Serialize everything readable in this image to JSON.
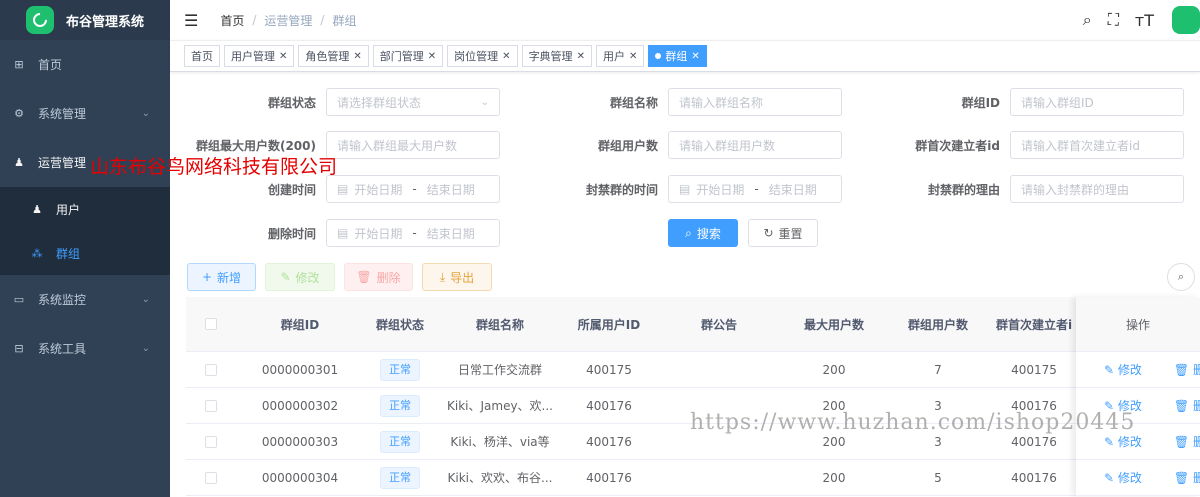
{
  "app": {
    "title": "布谷管理系统"
  },
  "sidebar": {
    "items": [
      {
        "label": "首页",
        "icon": "dashboard-icon"
      },
      {
        "label": "系统管理",
        "icon": "gear-icon"
      },
      {
        "label": "运营管理",
        "icon": "users-icon"
      },
      {
        "label": "系统监控",
        "icon": "monitor-icon"
      },
      {
        "label": "系统工具",
        "icon": "toolbox-icon"
      }
    ],
    "sub": [
      {
        "label": "用户"
      },
      {
        "label": "群组"
      }
    ]
  },
  "breadcrumb": {
    "home": "首页",
    "section": "运营管理",
    "current": "群组"
  },
  "tabs": [
    {
      "label": "首页"
    },
    {
      "label": "用户管理"
    },
    {
      "label": "角色管理"
    },
    {
      "label": "部门管理"
    },
    {
      "label": "岗位管理"
    },
    {
      "label": "字典管理"
    },
    {
      "label": "用户"
    },
    {
      "label": "群组"
    }
  ],
  "form": {
    "status_label": "群组状态",
    "status_placeholder": "请选择群组状态",
    "name_label": "群组名称",
    "name_placeholder": "请输入群组名称",
    "id_label": "群组ID",
    "id_placeholder": "请输入群组ID",
    "max_label": "群组最大用户数(200)",
    "max_placeholder": "请输入群组最大用户数",
    "users_label": "群组用户数",
    "users_placeholder": "请输入群组用户数",
    "creator_label": "群首次建立者id",
    "creator_placeholder": "请输入群首次建立者id",
    "created_label": "创建时间",
    "banned_label": "封禁群的时间",
    "reason_label": "封禁群的理由",
    "reason_placeholder": "请输入封禁群的理由",
    "deleted_label": "删除时间",
    "start_placeholder": "开始日期",
    "date_sep": "-",
    "end_placeholder": "结束日期",
    "search_label": "搜索",
    "reset_label": "重置"
  },
  "toolbar": {
    "add": "新增",
    "edit": "修改",
    "delete": "删除",
    "export": "导出"
  },
  "table": {
    "headers": [
      "群组ID",
      "群组状态",
      "群组名称",
      "所属用户ID",
      "群公告",
      "最大用户数",
      "群组用户数",
      "群首次建立者i",
      "操作"
    ],
    "rows": [
      {
        "id": "0000000301",
        "status": "正常",
        "name": "日常工作交流群",
        "owner": "400175",
        "notice": "",
        "max": "200",
        "count": "7",
        "creator": "400175"
      },
      {
        "id": "0000000302",
        "status": "正常",
        "name": "Kiki、Jamey、欢...",
        "owner": "400176",
        "notice": "",
        "max": "200",
        "count": "3",
        "creator": "400176"
      },
      {
        "id": "0000000303",
        "status": "正常",
        "name": "Kiki、杨洋、via等",
        "owner": "400176",
        "notice": "",
        "max": "200",
        "count": "3",
        "creator": "400176"
      },
      {
        "id": "0000000304",
        "status": "正常",
        "name": "Kiki、欢欢、布谷...",
        "owner": "400176",
        "notice": "",
        "max": "200",
        "count": "5",
        "creator": "400176"
      }
    ],
    "op_edit": "修改",
    "op_delete": "删除"
  },
  "watermarks": {
    "company": "山东布谷鸟网络科技有限公司",
    "url": "https://www.huzhan.com/ishop20445"
  }
}
